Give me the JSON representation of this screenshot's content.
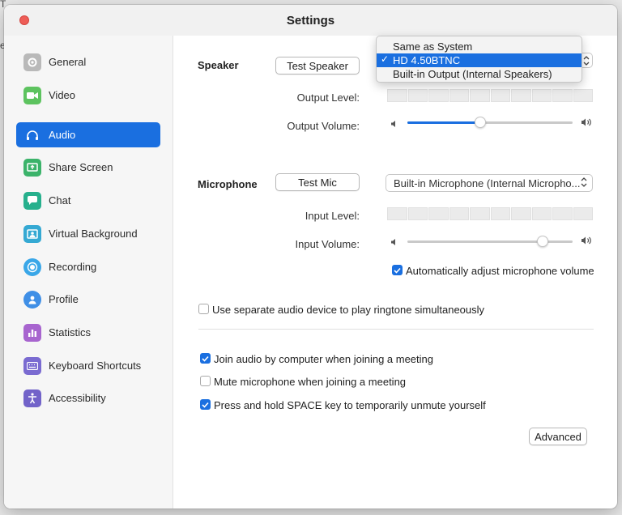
{
  "window": {
    "title": "Settings"
  },
  "background_fragments": [
    "T",
    "e"
  ],
  "sidebar": {
    "items": [
      {
        "label": "General",
        "icon": "gear-icon",
        "color": "#b9b9b9",
        "active": false
      },
      {
        "label": "Video",
        "icon": "video-camera-icon",
        "color": "#5dc35f",
        "active": false
      },
      {
        "label": "Audio",
        "icon": "headphones-icon",
        "color": "#1a6fe0",
        "active": true
      },
      {
        "label": "Share Screen",
        "icon": "share-screen-icon",
        "color": "#3bb36a",
        "active": false
      },
      {
        "label": "Chat",
        "icon": "chat-bubble-icon",
        "color": "#27b08d",
        "active": false
      },
      {
        "label": "Virtual Background",
        "icon": "virtual-background-icon",
        "color": "#35a9d3",
        "active": false
      },
      {
        "label": "Recording",
        "icon": "record-icon",
        "color": "#3aa7e8",
        "active": false
      },
      {
        "label": "Profile",
        "icon": "profile-icon",
        "color": "#3f8fe6",
        "active": false
      },
      {
        "label": "Statistics",
        "icon": "statistics-icon",
        "color": "#a865cf",
        "active": false
      },
      {
        "label": "Keyboard Shortcuts",
        "icon": "keyboard-icon",
        "color": "#7a6bd1",
        "active": false
      },
      {
        "label": "Accessibility",
        "icon": "accessibility-icon",
        "color": "#7263c9",
        "active": false
      }
    ]
  },
  "speaker": {
    "section_label": "Speaker",
    "test_button": "Test Speaker",
    "output_level_label": "Output Level:",
    "output_volume_label": "Output Volume:",
    "output_volume": 0.44,
    "dropdown": {
      "options": [
        "Same as System",
        "HD 4.50BTNC",
        "Built-in Output (Internal Speakers)"
      ],
      "selected_index": 1,
      "check_mark": "✓"
    }
  },
  "microphone": {
    "section_label": "Microphone",
    "test_button": "Test Mic",
    "selected_device": "Built-in Microphone (Internal Micropho...",
    "input_level_label": "Input Level:",
    "input_volume_label": "Input Volume:",
    "input_volume": 0.82,
    "auto_adjust_label": "Automatically adjust microphone volume",
    "auto_adjust_checked": true
  },
  "options": {
    "separate_device_label": "Use separate audio device to play ringtone simultaneously",
    "separate_device_checked": false,
    "join_audio_label": "Join audio by computer when joining a meeting",
    "join_audio_checked": true,
    "mute_mic_label": "Mute microphone when joining a meeting",
    "mute_mic_checked": false,
    "space_unmute_label": "Press and hold SPACE key to temporarily unmute yourself",
    "space_unmute_checked": true
  },
  "advanced_button": "Advanced",
  "colors": {
    "accent": "#1a6fe0",
    "close": "#ee5d57"
  }
}
